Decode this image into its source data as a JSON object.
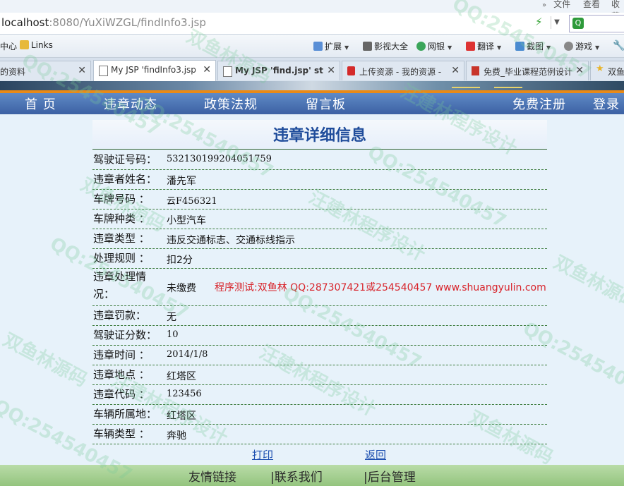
{
  "browser": {
    "menu": [
      "文件",
      "查看",
      "收藏"
    ],
    "address": {
      "host": "localhost",
      "rest": ":8080/YuXiWZGL/findInfo3.jsp"
    },
    "toolbar": {
      "left_items": [
        "中心",
        "Links"
      ],
      "right_items": [
        "扩展",
        "影视大全",
        "网银",
        "翻译",
        "截图",
        "游戏"
      ]
    },
    "tabs": [
      {
        "label": "的资料"
      },
      {
        "label": "My JSP 'findInfo3.jsp"
      },
      {
        "label": "My JSP 'find.jsp' st"
      },
      {
        "label": "上传资源 - 我的资源 -"
      },
      {
        "label": "免费_毕业课程范例设计"
      },
      {
        "label": "双鱼"
      }
    ]
  },
  "nav": {
    "items": [
      "首 页",
      "违章动态",
      "政策法规",
      "留言板",
      "免费注册",
      "登录"
    ]
  },
  "page": {
    "title": "违章详细信息",
    "fields": [
      {
        "label": "驾驶证号码：",
        "value": "532130199204051759"
      },
      {
        "label": "违章者姓名：",
        "value": "潘先军"
      },
      {
        "label": "车牌号码 ：",
        "value": "云F456321"
      },
      {
        "label": "车牌种类 ：",
        "value": "小型汽车"
      },
      {
        "label": "违章类型 ：",
        "value": "违反交通标志、交通标线指示"
      },
      {
        "label": "处理规则 ：",
        "value": "扣2分"
      },
      {
        "label": "违章处理情况：",
        "value": "未缴费"
      },
      {
        "label": "违章罚款：",
        "value": "无"
      },
      {
        "label": "驾驶证分数：",
        "value": "10"
      },
      {
        "label": "违章时间 ：",
        "value": "2014/1/8"
      },
      {
        "label": "违章地点 ：",
        "value": "红塔区"
      },
      {
        "label": "违章代码 ：",
        "value": "123456"
      },
      {
        "label": "车辆所属地：",
        "value": "红塔区"
      },
      {
        "label": "车辆类型 ：",
        "value": "奔驰"
      }
    ],
    "promo": "程序测试:双鱼林 QQ:287307421或254540457 www.shuangyulin.com",
    "print_label": "打印",
    "back_label": "返回"
  },
  "footer": {
    "items": [
      "友情链接",
      "|联系我们",
      "|后台管理"
    ]
  },
  "watermarks": [
    "QQ:254540457",
    "双鱼林源码",
    "汪建林程序设计"
  ]
}
